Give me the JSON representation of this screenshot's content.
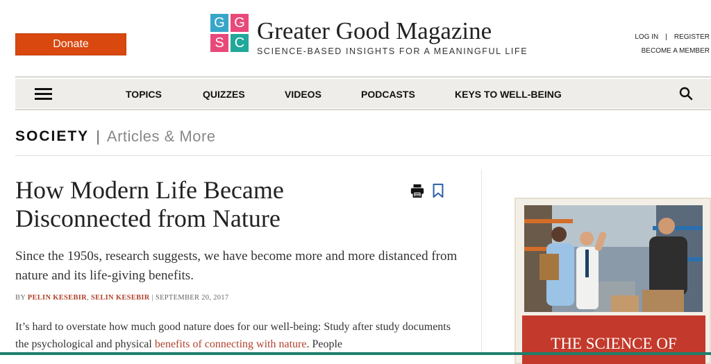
{
  "header": {
    "donate_label": "Donate",
    "logo_letters": [
      "G",
      "G",
      "S",
      "C"
    ],
    "logo_colors": [
      "#37a6c9",
      "#e8497a",
      "#e8497a",
      "#20a89a"
    ],
    "site_title": "Greater Good Magazine",
    "tagline": "SCIENCE-BASED INSIGHTS FOR A MEANINGFUL LIFE",
    "login_label": "LOG IN",
    "separator": "|",
    "register_label": "REGISTER",
    "member_label": "BECOME A MEMBER"
  },
  "nav": {
    "items": [
      {
        "label": "TOPICS"
      },
      {
        "label": "QUIZZES"
      },
      {
        "label": "VIDEOS"
      },
      {
        "label": "PODCASTS"
      },
      {
        "label": "KEYS TO WELL-BEING"
      }
    ]
  },
  "section": {
    "name": "SOCIETY",
    "pipe": "|",
    "subtitle": "Articles & More"
  },
  "article": {
    "title": "How Modern Life Became Disconnected from Nature",
    "subtitle": "Since the 1950s, research suggests, we have become more and more distanced from nature and its life-giving benefits.",
    "by": "BY",
    "authors": [
      "PELIN KESEBIR",
      "SELIN KESEBIR"
    ],
    "author_sep": ",",
    "date_sep": "|",
    "date": "SEPTEMBER 20, 2017",
    "body_start": "It’s hard to overstate how much good nature does for our well-being: Study after study documents the psychological and physical ",
    "body_link": "benefits of connecting with nature",
    "body_end": ". People"
  },
  "sidebar": {
    "promo_banner": "THE SCIENCE OF"
  },
  "colors": {
    "accent": "#d9480f",
    "link": "#b0412c",
    "nav_bg": "#eeede9",
    "bottom_bar": "#1e7f6c"
  }
}
